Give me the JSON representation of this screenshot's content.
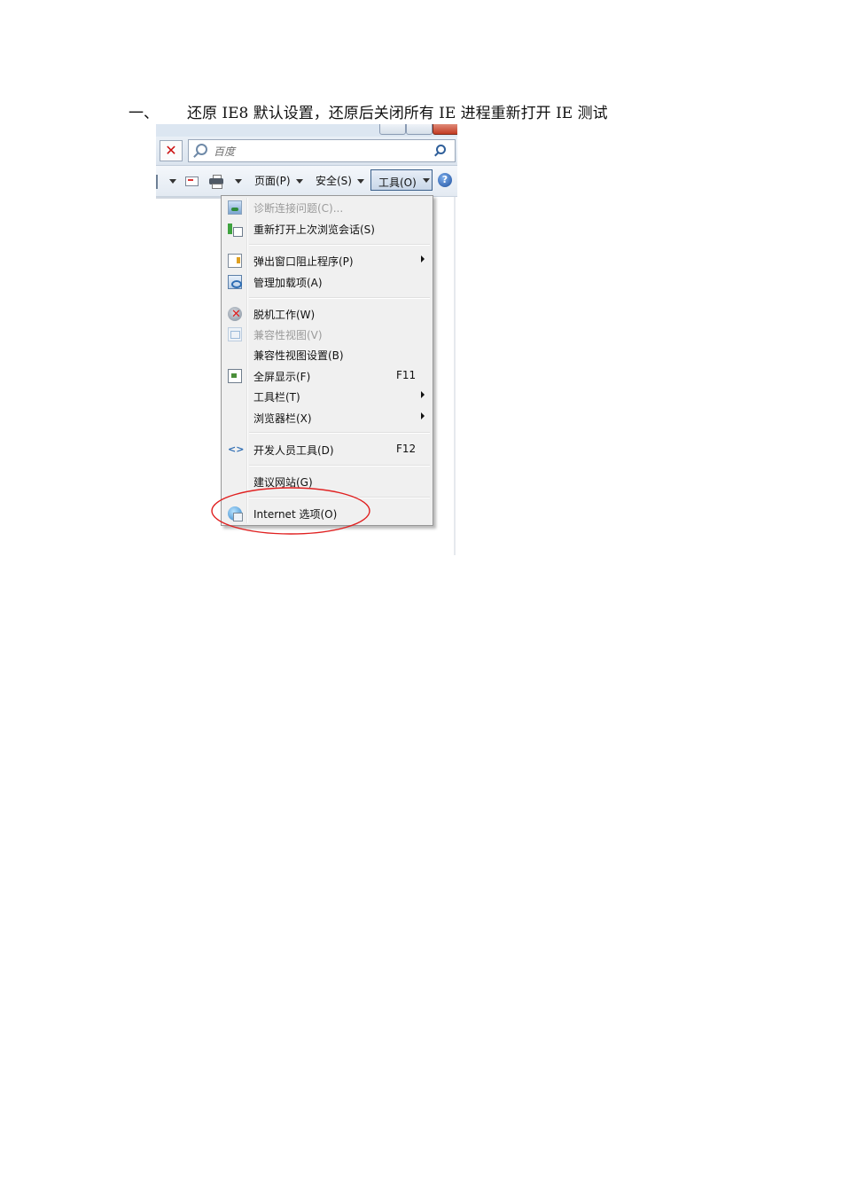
{
  "heading": {
    "number": "一、",
    "text": "还原 IE8 默认设置，还原后关闭所有 IE 进程重新打开 IE 测试"
  },
  "search": {
    "placeholder": "百度"
  },
  "command_bar": {
    "page_label": "页面(P)",
    "safety_label": "安全(S)",
    "tools_label": "工具(O)",
    "help_glyph": "?"
  },
  "tools_menu": {
    "items": [
      {
        "label": "诊断连接问题(C)...",
        "disabled": true,
        "icon": "diagnose-icon"
      },
      {
        "label": "重新打开上次浏览会话(S)",
        "disabled": false,
        "icon": "reopen-session-icon"
      },
      {
        "label": "弹出窗口阻止程序(P)",
        "disabled": false,
        "icon": "popup-blocker-icon",
        "submenu": true
      },
      {
        "label": "管理加载项(A)",
        "disabled": false,
        "icon": "add-ons-icon"
      },
      {
        "label": "脱机工作(W)",
        "disabled": false,
        "icon": "work-offline-icon"
      },
      {
        "label": "兼容性视图(V)",
        "disabled": true,
        "icon": "compatibility-view-icon"
      },
      {
        "label": "兼容性视图设置(B)",
        "disabled": false
      },
      {
        "label": "全屏显示(F)",
        "disabled": false,
        "icon": "full-screen-icon",
        "shortcut": "F11"
      },
      {
        "label": "工具栏(T)",
        "disabled": false,
        "submenu": true
      },
      {
        "label": "浏览器栏(X)",
        "disabled": false,
        "submenu": true
      },
      {
        "label": "开发人员工具(D)",
        "disabled": false,
        "icon": "developer-tools-icon",
        "shortcut": "F12"
      },
      {
        "label": "建议网站(G)",
        "disabled": false
      },
      {
        "label": "Internet 选项(O)",
        "disabled": false,
        "icon": "internet-options-icon",
        "highlighted_by_annotation": true
      }
    ]
  },
  "annotation": {
    "ring_color": "#e02020"
  }
}
